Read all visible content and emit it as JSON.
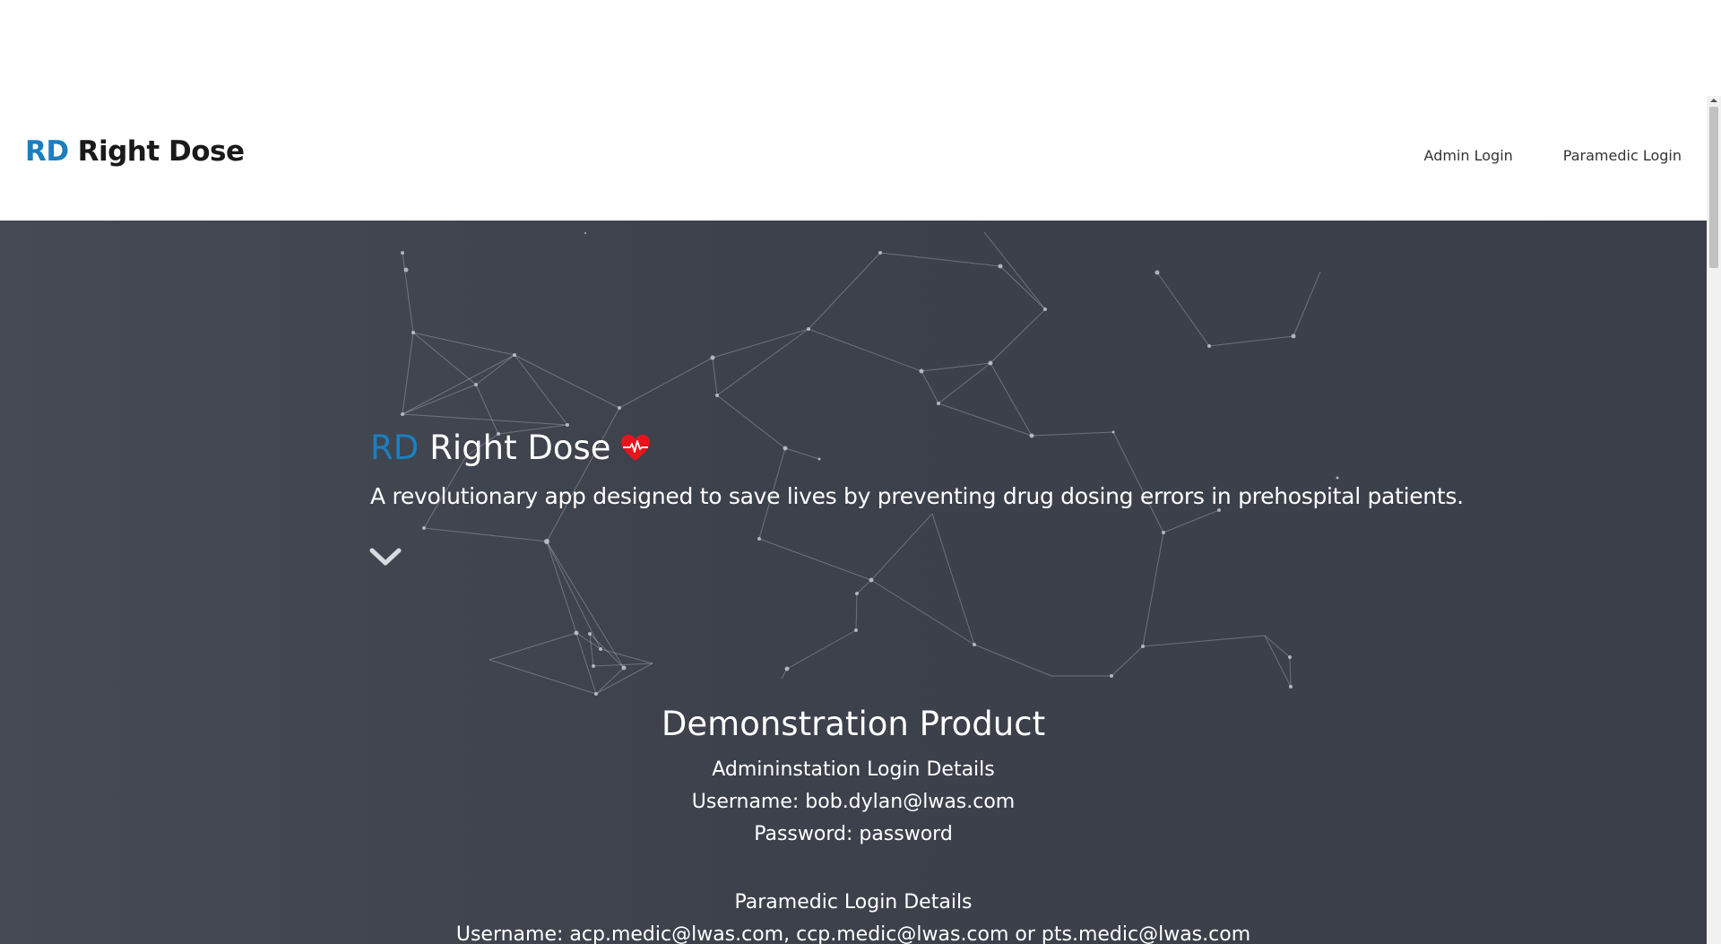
{
  "navbar": {
    "brand_abbrev": "RD",
    "brand_name": "Right Dose",
    "links": [
      {
        "label": "Admin Login"
      },
      {
        "label": "Paramedic Login"
      }
    ]
  },
  "hero": {
    "title_abbrev": "RD",
    "title_name": "Right Dose",
    "heart_icon": "heart-pulse-icon",
    "subtitle": "A revolutionary app designed to save lives by preventing drug dosing errors in prehospital patients.",
    "scroll_icon": "chevron-down-icon"
  },
  "demo": {
    "heading": "Demonstration Product",
    "admin_heading": "Admininstation Login Details",
    "admin_username": "Username: bob.dylan@lwas.com",
    "admin_password": "Password: password",
    "paramedic_heading": "Paramedic Login Details",
    "paramedic_username": "Username: acp.medic@lwas.com, ccp.medic@lwas.com or pts.medic@lwas.com"
  },
  "colors": {
    "accent": "#1a7fc1",
    "hero_bg": "#3c414b",
    "heart": "#e8141c"
  }
}
